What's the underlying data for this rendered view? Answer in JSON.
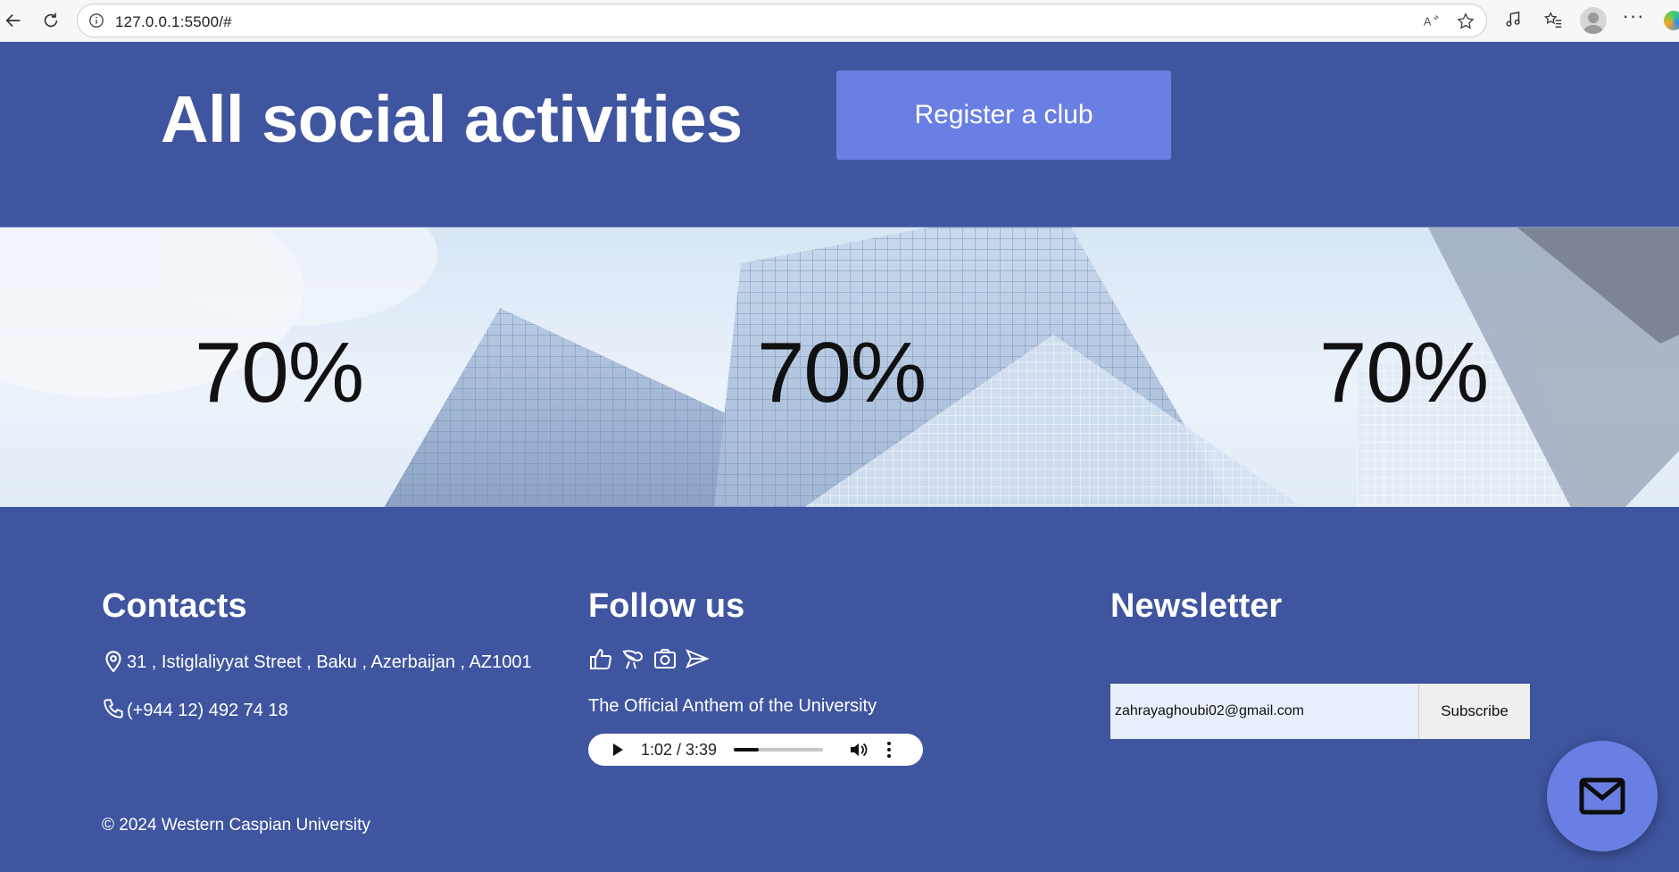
{
  "browser": {
    "url": "127.0.0.1:5500/#"
  },
  "hero": {
    "title": "All social activities",
    "register_label": "Register a club"
  },
  "stats": [
    {
      "value": "70%"
    },
    {
      "value": "70%"
    },
    {
      "value": "70%"
    }
  ],
  "footer": {
    "contacts": {
      "heading": "Contacts",
      "address": "31 , Istiglaliyyat Street , Baku , Azerbaijan , AZ1001",
      "phone": "(+944 12) 492 74 18"
    },
    "follow": {
      "heading": "Follow us",
      "social_icons": [
        "thumbs-up-icon",
        "bird-icon",
        "camera-icon",
        "send-icon"
      ],
      "anthem_label": "The Official Anthem of the University",
      "audio": {
        "time": "1:02 / 3:39",
        "progress_fraction": 0.28
      }
    },
    "newsletter": {
      "heading": "Newsletter",
      "email_value": "zahrayaghoubi02@gmail.com",
      "subscribe_label": "Subscribe"
    },
    "copyright": "© 2024 Western Caspian University"
  },
  "colors": {
    "brand_blue": "#3f55a0",
    "accent_blue": "#6a7fe3"
  }
}
